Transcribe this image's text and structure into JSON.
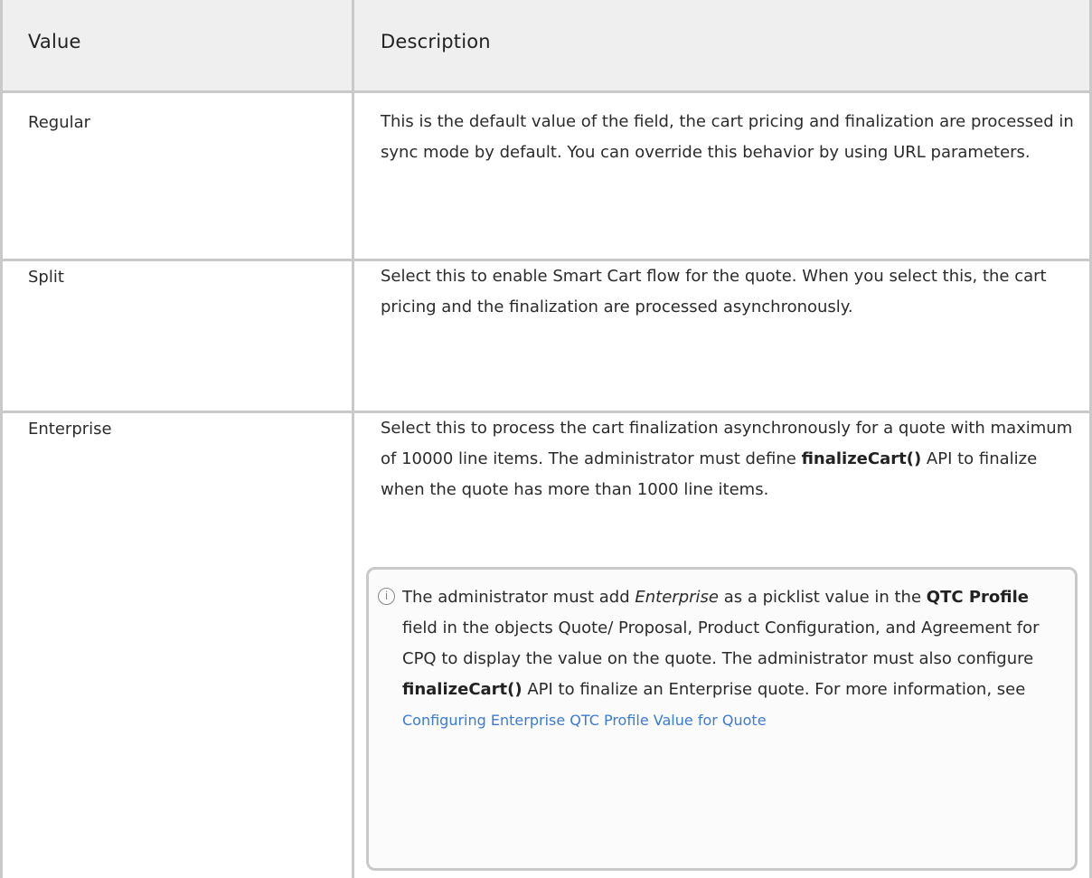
{
  "table": {
    "headers": {
      "value": "Value",
      "description": "Description"
    },
    "rows": [
      {
        "value": "Regular",
        "description": "This is the default value of the field, the cart pricing and finalization are processed in sync mode by default. You can override this behavior by using URL parameters."
      },
      {
        "value": "Split",
        "description": "Select this to enable Smart Cart flow for the quote. When you select this, the cart pricing and the finalization are processed asynchronously."
      },
      {
        "value": "Enterprise",
        "description_before": "Select this to process the cart finalization asynchronously for a quote with maximum of 10000 line items. The administrator must define ",
        "description_bold": "finalizeCart()",
        "description_after": " API to finalize when the quote has more than 1000 line items.",
        "note": {
          "icon": "info-icon",
          "icon_glyph": "i",
          "t1": "The administrator must add ",
          "t1_italic": "Enterprise",
          "t2": " as a picklist value in the ",
          "t2_bold": "QTC Profile",
          "t3": " field in the objects Quote/ Proposal, Product Configuration, and Agreement for CPQ to display the value on the quote. The administrator must also configure ",
          "t3_bold": "finalizeCart()",
          "t4": " API to finalize an Enterprise quote.  For more information, see ",
          "link": "Configuring Enterprise QTC Profile Value for Quote"
        }
      }
    ]
  }
}
